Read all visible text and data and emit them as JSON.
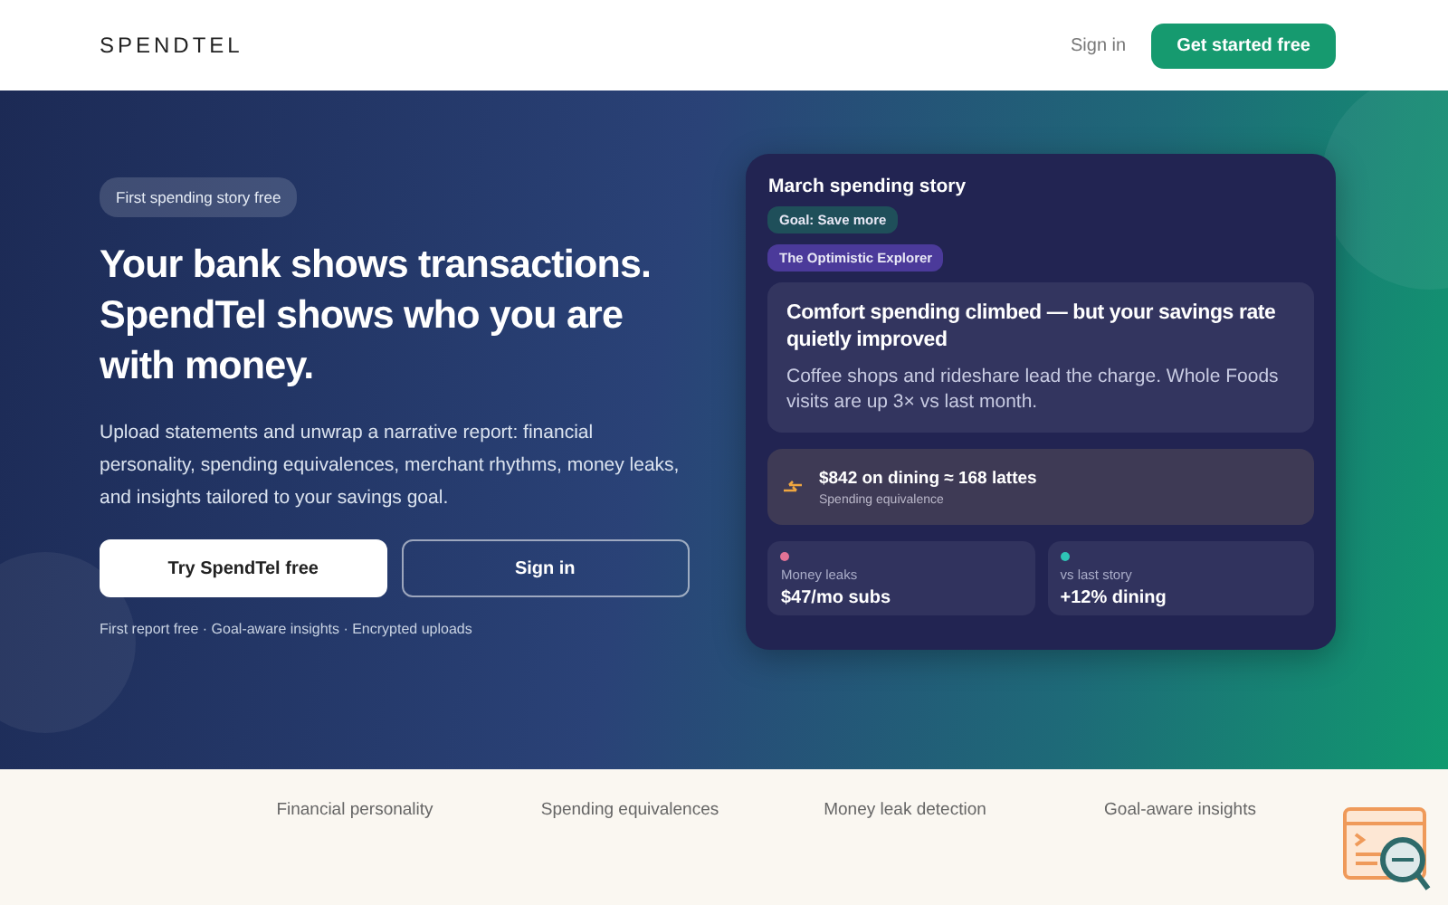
{
  "header": {
    "logo": "SPENDTEL",
    "sign_in": "Sign in",
    "cta": "Get started free"
  },
  "hero": {
    "badge": "First spending story free",
    "title": "Your bank shows transactions. SpendTel shows who you are with money.",
    "description": "Upload statements and unwrap a narrative report: financial personality, spending equivalences, merchant rhythms, money leaks, and insights tailored to your savings goal.",
    "primary_button": "Try SpendTel free",
    "secondary_button": "Sign in",
    "footnote": "First report free · Goal-aware insights · Encrypted uploads"
  },
  "story_card": {
    "title": "March spending story",
    "tags": [
      {
        "label": "Goal: Save more",
        "color": "#1f4f5a"
      },
      {
        "label": "The Optimistic Explorer",
        "color": "#4b3a9a"
      }
    ],
    "headline": "Comfort spending climbed — but your savings rate quietly improved",
    "summary": "Coffee shops and rideshare lead the charge. Whole Foods visits are up 3× vs last month.",
    "equivalence": {
      "value": "$842 on dining ≈ 168 lattes",
      "label": "Spending equivalence"
    },
    "stats": [
      {
        "label": "Money leaks",
        "value": "$47/mo subs",
        "color": "#e27396"
      },
      {
        "label": "vs last story",
        "value": "+12% dining",
        "color": "#2ec4b6"
      }
    ]
  },
  "features": [
    "Financial personality",
    "Spending equivalences",
    "Money leak detection",
    "Goal-aware insights"
  ]
}
